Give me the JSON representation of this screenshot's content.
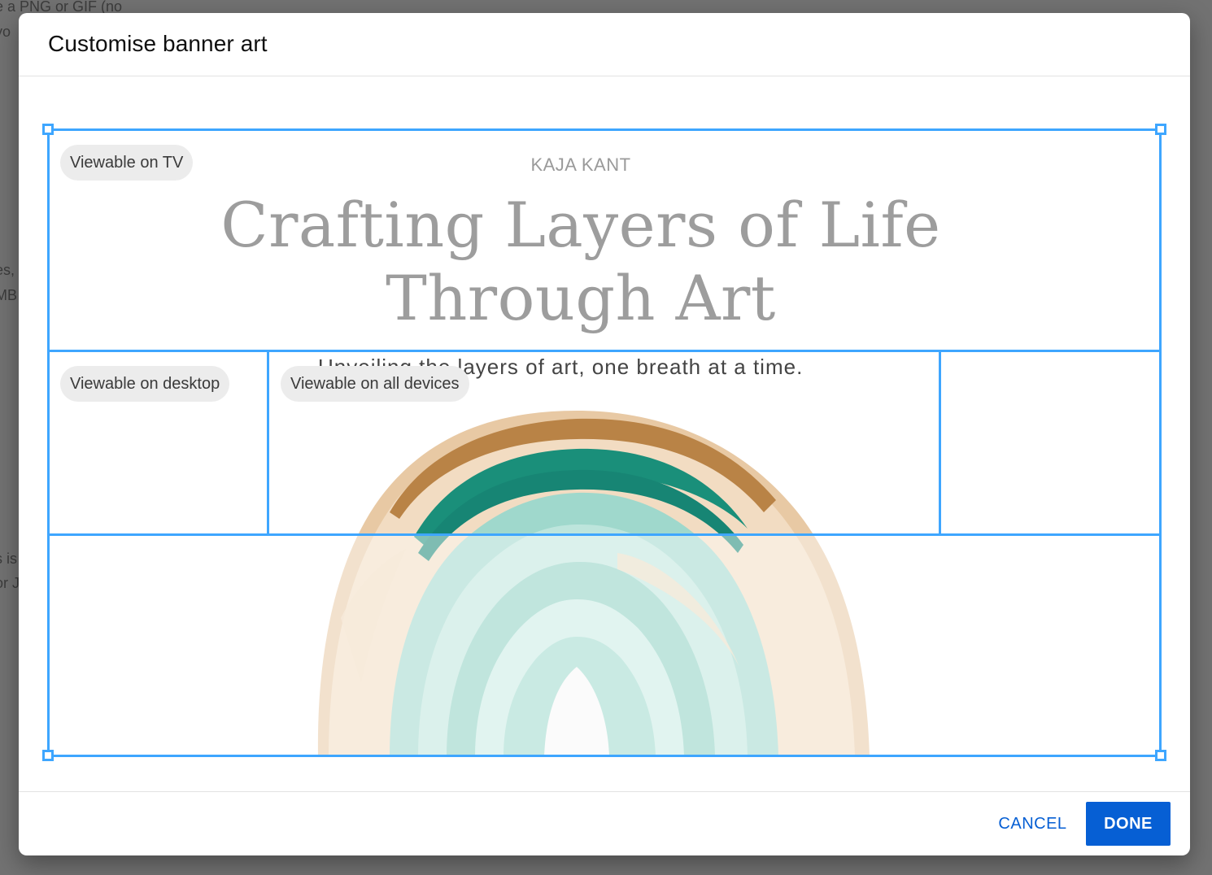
{
  "background": {
    "fragments": [
      "e a PNG or GIF (no",
      "yo",
      ".",
      "es, t",
      "MB",
      "s is",
      "or J"
    ]
  },
  "dialog": {
    "title": "Customise banner art",
    "cancel_label": "CANCEL",
    "done_label": "DONE"
  },
  "banner": {
    "brand": "KAJA KANT",
    "headline_line1": "Crafting Layers of Life",
    "headline_line2": "Through Art",
    "tagline": "Unveiling the layers of art, one breath at a time."
  },
  "crop": {
    "tv_label": "Viewable on TV",
    "desktop_label": "Viewable on desktop",
    "all_devices_label": "Viewable on all devices"
  },
  "colors": {
    "accent": "#3ea6ff",
    "primary_button": "#065fd4",
    "teal": "#1c9a83",
    "gold": "#c08a4a"
  }
}
